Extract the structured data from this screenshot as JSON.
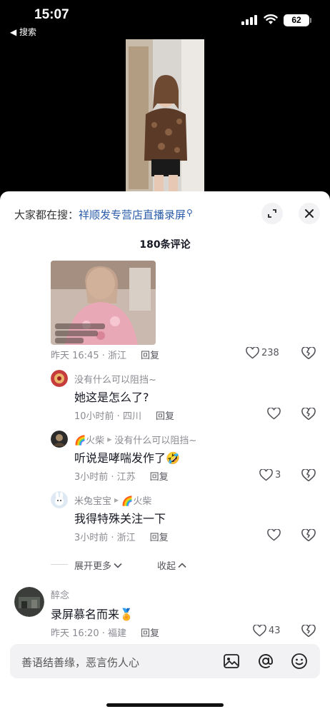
{
  "status_bar": {
    "time": "15:07",
    "back_label": "◀ 搜索",
    "battery": "62"
  },
  "sheet": {
    "search_prefix": "大家都在搜：",
    "search_keyword": "祥顺发专营店直播录屏",
    "comment_count": "180条评论"
  },
  "comments": [
    {
      "type": "image",
      "time_loc": "昨天 16:45 · 浙江",
      "reply": "回复",
      "likes": "238"
    }
  ],
  "replies": [
    {
      "username": "没有什么可以阻挡~",
      "reply_to": "",
      "text": "她这是怎么了?",
      "time_loc": "10小时前 · 四川",
      "reply": "回复",
      "likes": ""
    },
    {
      "username": "🌈火柴",
      "reply_to": "没有什么可以阻挡~",
      "text": "听说是哮喘发作了🤣",
      "time_loc": "3小时前 · 江苏",
      "reply": "回复",
      "likes": "3"
    },
    {
      "username": "米兔宝宝",
      "reply_to": "🌈火柴",
      "text": "我得特殊关注一下",
      "time_loc": "3小时前 · 浙江",
      "reply": "回复",
      "likes": ""
    }
  ],
  "thread_controls": {
    "expand_more": "展开更多",
    "collapse": "收起"
  },
  "comment2": {
    "username": "醉念",
    "text": "录屏慕名而来🏅",
    "time_loc": "昨天 16:20 · 福建",
    "reply": "回复",
    "likes": "43"
  },
  "input": {
    "placeholder": "善语结善缘，恶言伤人心"
  },
  "icons": {
    "expand": "expand-icon",
    "close": "close-icon",
    "like": "heart-icon",
    "dislike": "broken-heart-icon",
    "image": "image-icon",
    "mention": "at-icon",
    "emoji": "emoji-icon"
  }
}
